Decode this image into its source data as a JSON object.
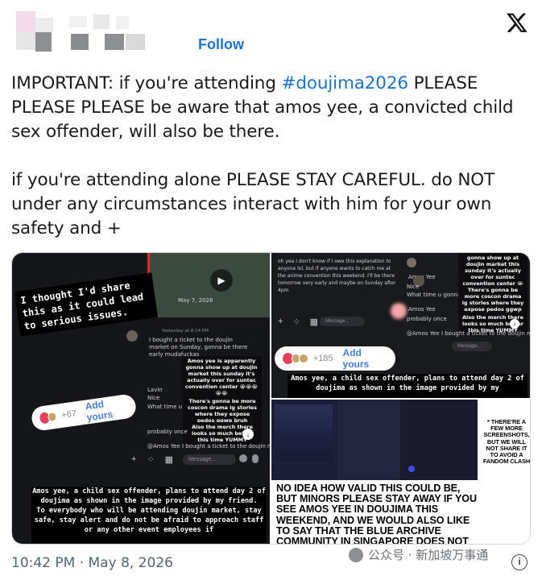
{
  "header": {
    "follow_label": "Follow"
  },
  "tweet": {
    "para1_pre": "IMPORTANT: if you're attending ",
    "hashtag": "#doujima2026",
    "para1_post": " PLEASE PLEASE PLEASE be aware that amos yee, a convicted child sex offender, will also be there.",
    "para2": "if you're attending alone PLEASE STAY CAREFUL. do NOT under any circumstances interact with him for your own safety and +"
  },
  "panel_a": {
    "sticker": "I thought I'd share this as it could lead to serious issues.",
    "date": "May 7, 2026",
    "msg1_time": "Yesterday at 8:14 PM",
    "msg1": "I bought a ticket to the doujin market on Sunday, gonna be there early mudafuckas",
    "bubble1": "Amos yee is apparently gonna show up at doujin market this sunday it's actually over for suntec convention center 😭😭😭😭😭",
    "msg2": "Lavin",
    "msg2b": "Nice",
    "msg3": "What time u gonna b there",
    "bubble2": "There's gonna be more coscon drama ig stories where they expose pedos ggwp bruh",
    "bubble3": "Also the merch there looks so much better this time YUMMY",
    "msg4": "probably once",
    "msg5": "@Amos Yee I bought a ticket to the doujin market",
    "pill_count": "+67",
    "pill_add": "Add yours",
    "msg_placeholder": "Message...",
    "caption": "Amos yee, a child sex offender, plans to attend day 2 of doujima as shown in the image provided by my friend.\nTo everybody who will be attending doujin market, stay safe, stay alert and do not be afraid to approach staff or any other event employees if"
  },
  "panel_b": {
    "msg1": "oh yea I don't know if I owe this explanation to anyone lol, but if anyone wants to catch me at the anime convention this weekend. I'll be there tomorrow very early and maybe on Sunday after 4pm",
    "name": "Amos Yee",
    "bubble1": "gonna show up at doujin market this sunday it's actually over for suntec convention center 😭😭😭😭😭",
    "msg2": "Nice",
    "msg3": "What time u gonna b there",
    "bubble2": "There's gonna be more coscon drama ig stories where they expose pedos ggwp bruh",
    "bubble3": "Also the merch there looks so much better this time YUMMY",
    "msg4": "probably once",
    "msg5": "@Amos Yee I bought a ticket to the doujin market",
    "pill_count": "+185",
    "pill_add": "Add yours",
    "msg_placeholder": "Message...",
    "caption": "Amos yee, a child sex offender, plans to attend day 2 of doujima as shown in the image provided by my"
  },
  "panel_c": {
    "caps_main": "NO IDEA HOW VALID THIS COULD BE, BUT MINORS PLEASE STAY AWAY IF YOU SEE AMOS YEE IN DOUJIMA THIS WEEKEND, AND WE WOULD ALSO LIKE TO SAY THAT THE BLUE ARCHIVE COMMUNITY IN SINGAPORE DOES NOT",
    "caps_side": "* THERE'RE A FEW MORE SCREENSHOTS, BUT WE WILL NOT SHARE IT TO AVOID A FANDOM CLASH"
  },
  "footer": {
    "timestamp": "10:42 PM · May 8, 2026",
    "watermark": "公众号 · 新加坡万事通"
  }
}
